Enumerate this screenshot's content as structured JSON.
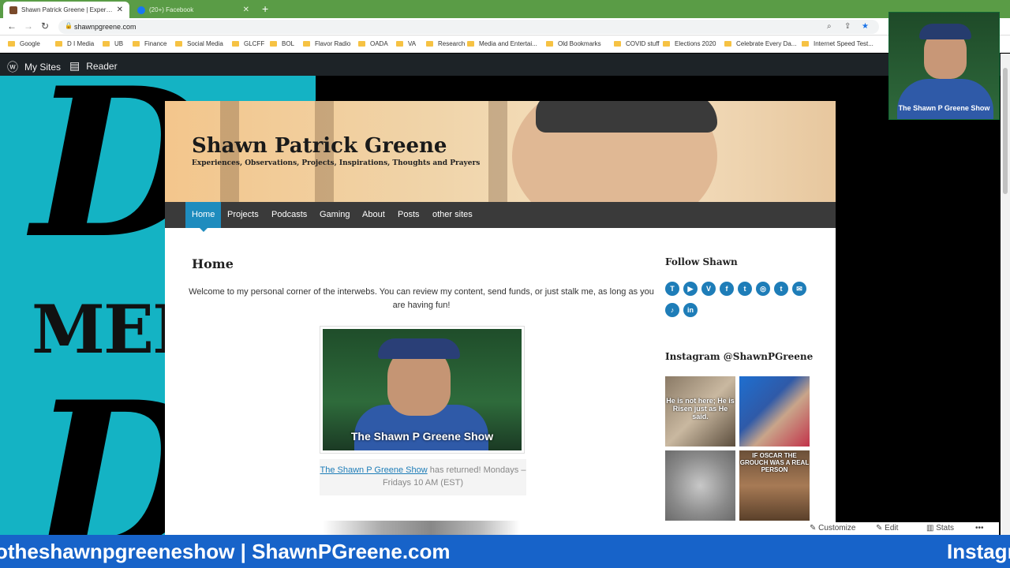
{
  "browser": {
    "tabs": [
      {
        "title": "Shawn Patrick Greene | Experien",
        "active": true
      },
      {
        "title": "(20+) Facebook",
        "active": false
      }
    ],
    "url": "shawnpgreene.com",
    "bookmarks": [
      "Google",
      "D I Media",
      "UB",
      "Finance",
      "Social Media",
      "GLCFF",
      "BOL",
      "Flavor Radio",
      "OADA",
      "VA",
      "Research",
      "Media and Entertai...",
      "Old Bookmarks",
      "COVID stuff",
      "Elections 2020",
      "Celebrate Every Da...",
      "Internet Speed Test..."
    ]
  },
  "wp_admin": {
    "my_sites": "My Sites",
    "reader": "Reader"
  },
  "background": {
    "brand_top": "D",
    "brand_med": "MED",
    "brand_bottom": "D"
  },
  "site": {
    "title": "Shawn Patrick Greene",
    "tagline": "Experiences, Observations, Projects, Inspirations, Thoughts and Prayers",
    "menu": [
      "Home",
      "Projects",
      "Podcasts",
      "Gaming",
      "About",
      "Posts",
      "other sites"
    ],
    "page_heading": "Home",
    "intro": "Welcome to my personal corner of the interwebs. You can review my content, send funds, or just stalk me, as long as you are having fun!",
    "video_title": "The Shawn P Greene Show",
    "caption_link": "The Shawn P Greene Show",
    "caption_rest": " has returned! Mondays – Fridays 10 AM (EST)"
  },
  "sidebar": {
    "follow_heading": "Follow Shawn",
    "social": [
      {
        "name": "twitch",
        "glyph": "T"
      },
      {
        "name": "youtube",
        "glyph": "▶"
      },
      {
        "name": "vimeo",
        "glyph": "V"
      },
      {
        "name": "facebook",
        "glyph": "f"
      },
      {
        "name": "twitter",
        "glyph": "t"
      },
      {
        "name": "instagram",
        "glyph": "◎"
      },
      {
        "name": "tumblr",
        "glyph": "t"
      },
      {
        "name": "email",
        "glyph": "✉"
      },
      {
        "name": "tiktok",
        "glyph": "♪"
      },
      {
        "name": "linkedin",
        "glyph": "in"
      }
    ],
    "instagram_heading": "Instagram @ShawnPGreene",
    "instagram_texts": [
      "He is not here; He is Risen just as He said.",
      "",
      "",
      "IF OSCAR THE GROUCH WAS A REAL PERSON"
    ]
  },
  "wp_actions": {
    "customize": "Customize",
    "edit": "Edit",
    "stats": "Stats",
    "more": "•••"
  },
  "webcam_caption": "The Shawn P Greene Show",
  "ticker": {
    "left": "otheshawnpgreeneshow | ShawnPGreene.com",
    "right": "Instagr"
  }
}
